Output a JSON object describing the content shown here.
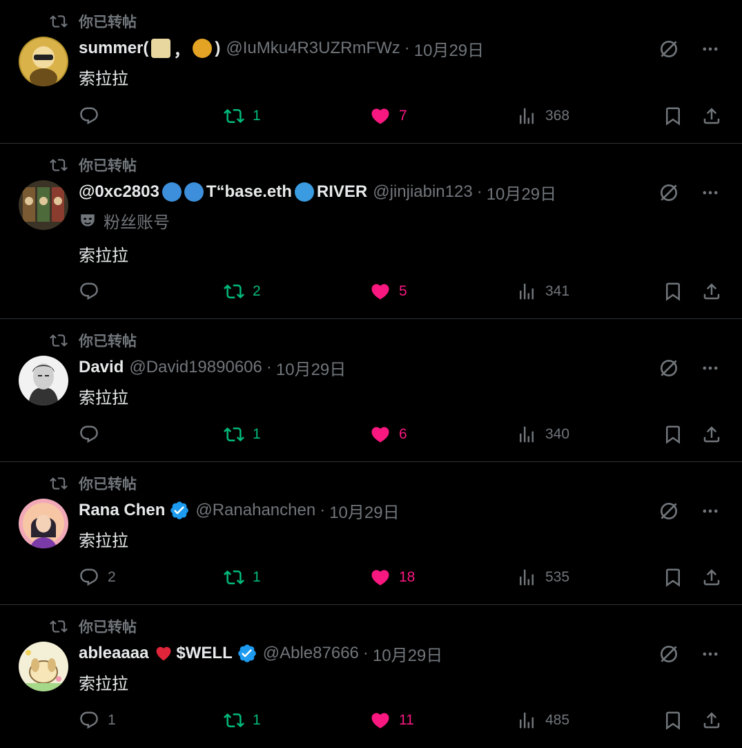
{
  "feed": {
    "posts": [
      {
        "repost_label": "你已转帖",
        "name": "summer(",
        "name_mid": "，",
        "name_end": ")",
        "handle": "@IuMku4R3UZRmFWz",
        "date": "10月29日",
        "text": "索拉拉",
        "replies": "",
        "reposts": "1",
        "likes": "7",
        "views": "368"
      },
      {
        "repost_label": "你已转帖",
        "name": "@0xc2803",
        "name_mid": "T“base.eth",
        "name_end": "RIVER",
        "handle": "@jinjiabin123",
        "date": "10月29日",
        "subtitle": "粉丝账号",
        "text": "索拉拉",
        "replies": "",
        "reposts": "2",
        "likes": "5",
        "views": "341"
      },
      {
        "repost_label": "你已转帖",
        "name": "David",
        "handle": "@David19890606",
        "date": "10月29日",
        "text": "索拉拉",
        "replies": "",
        "reposts": "1",
        "likes": "6",
        "views": "340"
      },
      {
        "repost_label": "你已转帖",
        "name": "Rana Chen",
        "handle": "@Ranahanchen",
        "date": "10月29日",
        "text": "索拉拉",
        "replies": "2",
        "reposts": "1",
        "likes": "18",
        "views": "535"
      },
      {
        "repost_label": "你已转帖",
        "name": "ableaaaa",
        "name_end": "$WELL",
        "handle": "@Able87666",
        "date": "10月29日",
        "text": "索拉拉",
        "replies": "1",
        "reposts": "1",
        "likes": "11",
        "views": "485"
      }
    ],
    "separator": "·"
  },
  "colors": {
    "background": "#000000",
    "muted": "#71767b",
    "repost": "#00ba7c",
    "like": "#f91880",
    "verified": "#1d9bf0"
  }
}
